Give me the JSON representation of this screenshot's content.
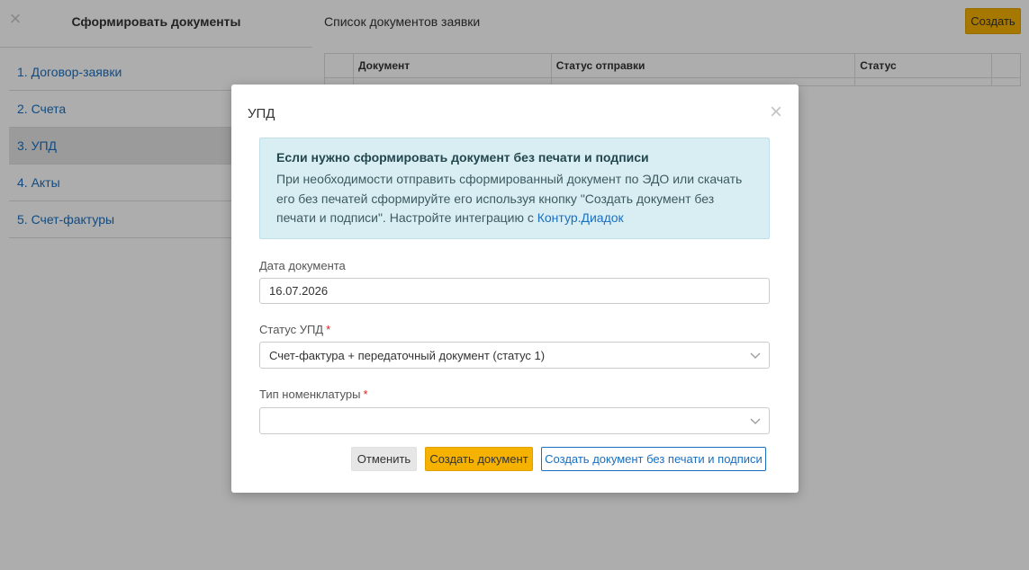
{
  "sidebar": {
    "title": "Сформировать документы",
    "items": [
      {
        "label": "1. Договор-заявки"
      },
      {
        "label": "2. Счета"
      },
      {
        "label": "3. УПД"
      },
      {
        "label": "4. Акты"
      },
      {
        "label": "5. Счет-фактуры"
      }
    ]
  },
  "main": {
    "title": "Список документов заявки",
    "create_label": "Создать",
    "table": {
      "columns": [
        "Документ",
        "Статус отправки",
        "Статус"
      ]
    }
  },
  "modal": {
    "title": "УПД",
    "alert": {
      "title": "Если нужно сформировать документ без печати и подписи",
      "text": "При необходимости отправить сформированный документ по ЭДО или скачать его без печатей сформируйте его используя кнопку \"Создать документ без печати и подписи\". Настройте интеграцию с ",
      "link": "Контур.Диадок"
    },
    "date": {
      "label": "Дата документа",
      "value": "16.07.2026"
    },
    "status": {
      "label": "Статус УПД",
      "required_mark": "*",
      "value": "Счет-фактура + передаточный документ (статус 1)"
    },
    "nomenclature": {
      "label": "Тип номенклатуры",
      "required_mark": "*",
      "value": ""
    },
    "buttons": {
      "cancel": "Отменить",
      "create": "Создать документ",
      "create_plain": "Создать документ без печати и подписи"
    }
  },
  "colors": {
    "accent": "#f5b200",
    "link": "#1a6fbf",
    "alert_bg": "#d9eef3",
    "required": "#e02020"
  },
  "icons": {
    "sidebar_close": "close-icon",
    "modal_close": "close-icon",
    "select_chevron": "chevron-down-icon"
  }
}
